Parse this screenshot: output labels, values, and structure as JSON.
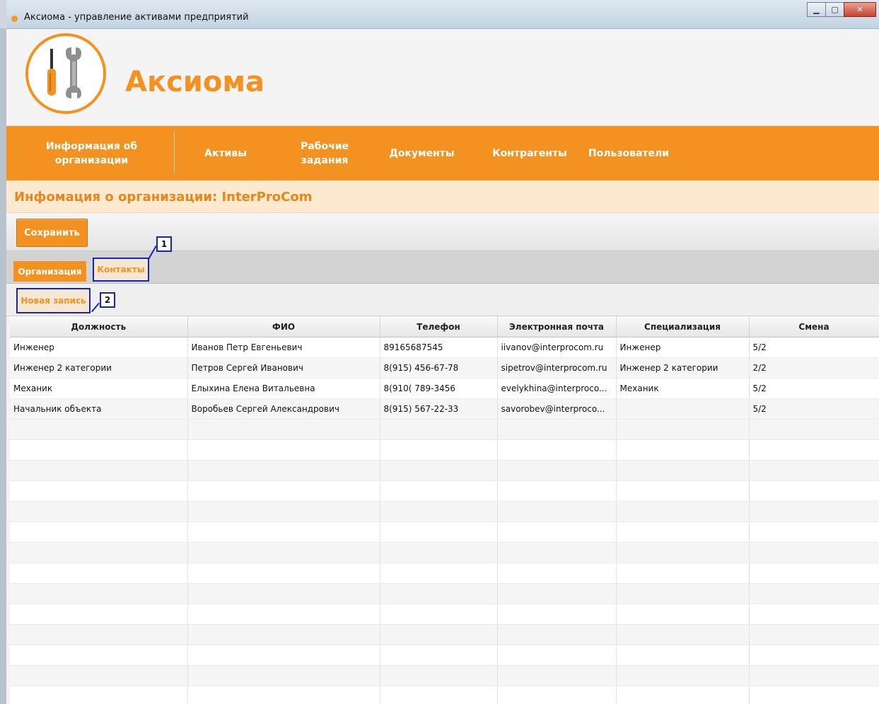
{
  "window": {
    "title": "Аксиома - управление активами предприятий",
    "controls": [
      "minimize",
      "maximize",
      "close"
    ]
  },
  "header": {
    "brand": "Аксиома",
    "logo_icon": "wrench-screwdriver-icon"
  },
  "nav": {
    "items": [
      {
        "label_line1": "Информация об",
        "label_line2": "организации"
      },
      {
        "label_line1": "Активы",
        "label_line2": ""
      },
      {
        "label_line1": "Рабочие",
        "label_line2": "задания"
      },
      {
        "label_line1": "Документы",
        "label_line2": ""
      },
      {
        "label_line1": "Контрагенты",
        "label_line2": ""
      },
      {
        "label_line1": "Пользователи",
        "label_line2": ""
      }
    ]
  },
  "section": {
    "title": "Инфомация о организации: InterProCom"
  },
  "toolbar": {
    "save_label": "Сохранить"
  },
  "tabs": {
    "items": [
      {
        "label": "Организация",
        "active": true
      },
      {
        "label": "Контакты",
        "active": false
      }
    ]
  },
  "subtoolbar": {
    "new_record_label": "Новая запись"
  },
  "callouts": {
    "one": "1",
    "two": "2"
  },
  "table": {
    "columns": [
      "Должность",
      "ФИО",
      "Телефон",
      "Электронная почта",
      "Специализация",
      "Смена"
    ],
    "rows": [
      [
        "Инженер",
        "Иванов Петр Евгеньевич",
        "89165687545",
        "iivanov@interprocom.ru",
        "Инженер",
        "5/2"
      ],
      [
        "Инженер 2 категории",
        "Петров Сергей Иванович",
        "8(915) 456-67-78",
        "sipetrov@interprocom.ru",
        "Инженер 2 категории",
        "2/2"
      ],
      [
        "Механик",
        "Елыхина Елена Витальевна",
        "8(910( 789-3456",
        "evelykhina@interproco...",
        "Механик",
        "5/2"
      ],
      [
        "Начальник объекта",
        "Воробьев Сергей Александрович",
        "8(915) 567-22-33",
        "savorobev@interproco...",
        "",
        "5/2"
      ]
    ]
  },
  "colors": {
    "accent": "#f49221",
    "title_bar_bg": "#fde9cf",
    "highlight_border": "#1423c7"
  }
}
